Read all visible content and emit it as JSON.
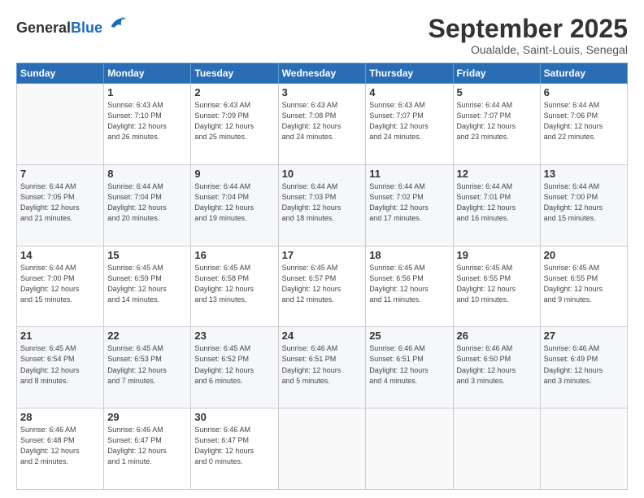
{
  "logo": {
    "general": "General",
    "blue": "Blue"
  },
  "header": {
    "month": "September 2025",
    "location": "Oualalde, Saint-Louis, Senegal"
  },
  "weekdays": [
    "Sunday",
    "Monday",
    "Tuesday",
    "Wednesday",
    "Thursday",
    "Friday",
    "Saturday"
  ],
  "weeks": [
    [
      {
        "day": "",
        "info": ""
      },
      {
        "day": "1",
        "info": "Sunrise: 6:43 AM\nSunset: 7:10 PM\nDaylight: 12 hours\nand 26 minutes."
      },
      {
        "day": "2",
        "info": "Sunrise: 6:43 AM\nSunset: 7:09 PM\nDaylight: 12 hours\nand 25 minutes."
      },
      {
        "day": "3",
        "info": "Sunrise: 6:43 AM\nSunset: 7:08 PM\nDaylight: 12 hours\nand 24 minutes."
      },
      {
        "day": "4",
        "info": "Sunrise: 6:43 AM\nSunset: 7:07 PM\nDaylight: 12 hours\nand 24 minutes."
      },
      {
        "day": "5",
        "info": "Sunrise: 6:44 AM\nSunset: 7:07 PM\nDaylight: 12 hours\nand 23 minutes."
      },
      {
        "day": "6",
        "info": "Sunrise: 6:44 AM\nSunset: 7:06 PM\nDaylight: 12 hours\nand 22 minutes."
      }
    ],
    [
      {
        "day": "7",
        "info": "Sunrise: 6:44 AM\nSunset: 7:05 PM\nDaylight: 12 hours\nand 21 minutes."
      },
      {
        "day": "8",
        "info": "Sunrise: 6:44 AM\nSunset: 7:04 PM\nDaylight: 12 hours\nand 20 minutes."
      },
      {
        "day": "9",
        "info": "Sunrise: 6:44 AM\nSunset: 7:04 PM\nDaylight: 12 hours\nand 19 minutes."
      },
      {
        "day": "10",
        "info": "Sunrise: 6:44 AM\nSunset: 7:03 PM\nDaylight: 12 hours\nand 18 minutes."
      },
      {
        "day": "11",
        "info": "Sunrise: 6:44 AM\nSunset: 7:02 PM\nDaylight: 12 hours\nand 17 minutes."
      },
      {
        "day": "12",
        "info": "Sunrise: 6:44 AM\nSunset: 7:01 PM\nDaylight: 12 hours\nand 16 minutes."
      },
      {
        "day": "13",
        "info": "Sunrise: 6:44 AM\nSunset: 7:00 PM\nDaylight: 12 hours\nand 15 minutes."
      }
    ],
    [
      {
        "day": "14",
        "info": "Sunrise: 6:44 AM\nSunset: 7:00 PM\nDaylight: 12 hours\nand 15 minutes."
      },
      {
        "day": "15",
        "info": "Sunrise: 6:45 AM\nSunset: 6:59 PM\nDaylight: 12 hours\nand 14 minutes."
      },
      {
        "day": "16",
        "info": "Sunrise: 6:45 AM\nSunset: 6:58 PM\nDaylight: 12 hours\nand 13 minutes."
      },
      {
        "day": "17",
        "info": "Sunrise: 6:45 AM\nSunset: 6:57 PM\nDaylight: 12 hours\nand 12 minutes."
      },
      {
        "day": "18",
        "info": "Sunrise: 6:45 AM\nSunset: 6:56 PM\nDaylight: 12 hours\nand 11 minutes."
      },
      {
        "day": "19",
        "info": "Sunrise: 6:45 AM\nSunset: 6:55 PM\nDaylight: 12 hours\nand 10 minutes."
      },
      {
        "day": "20",
        "info": "Sunrise: 6:45 AM\nSunset: 6:55 PM\nDaylight: 12 hours\nand 9 minutes."
      }
    ],
    [
      {
        "day": "21",
        "info": "Sunrise: 6:45 AM\nSunset: 6:54 PM\nDaylight: 12 hours\nand 8 minutes."
      },
      {
        "day": "22",
        "info": "Sunrise: 6:45 AM\nSunset: 6:53 PM\nDaylight: 12 hours\nand 7 minutes."
      },
      {
        "day": "23",
        "info": "Sunrise: 6:45 AM\nSunset: 6:52 PM\nDaylight: 12 hours\nand 6 minutes."
      },
      {
        "day": "24",
        "info": "Sunrise: 6:46 AM\nSunset: 6:51 PM\nDaylight: 12 hours\nand 5 minutes."
      },
      {
        "day": "25",
        "info": "Sunrise: 6:46 AM\nSunset: 6:51 PM\nDaylight: 12 hours\nand 4 minutes."
      },
      {
        "day": "26",
        "info": "Sunrise: 6:46 AM\nSunset: 6:50 PM\nDaylight: 12 hours\nand 3 minutes."
      },
      {
        "day": "27",
        "info": "Sunrise: 6:46 AM\nSunset: 6:49 PM\nDaylight: 12 hours\nand 3 minutes."
      }
    ],
    [
      {
        "day": "28",
        "info": "Sunrise: 6:46 AM\nSunset: 6:48 PM\nDaylight: 12 hours\nand 2 minutes."
      },
      {
        "day": "29",
        "info": "Sunrise: 6:46 AM\nSunset: 6:47 PM\nDaylight: 12 hours\nand 1 minute."
      },
      {
        "day": "30",
        "info": "Sunrise: 6:46 AM\nSunset: 6:47 PM\nDaylight: 12 hours\nand 0 minutes."
      },
      {
        "day": "",
        "info": ""
      },
      {
        "day": "",
        "info": ""
      },
      {
        "day": "",
        "info": ""
      },
      {
        "day": "",
        "info": ""
      }
    ]
  ]
}
